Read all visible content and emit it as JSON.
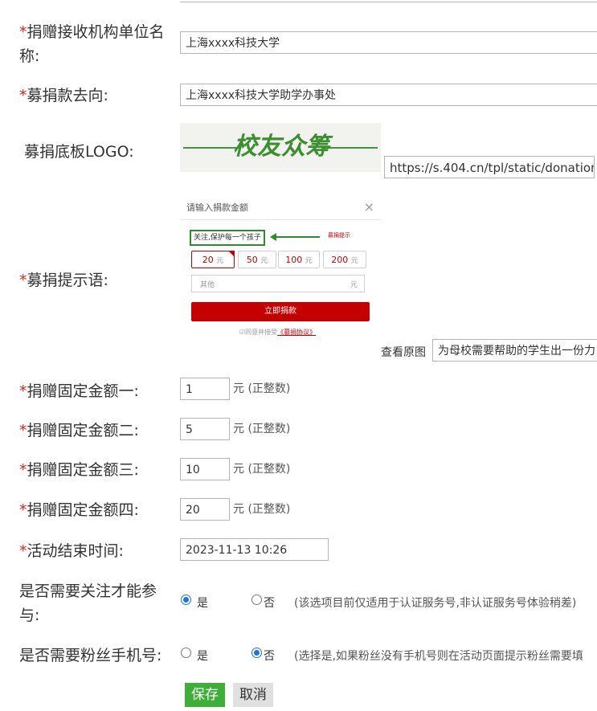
{
  "fields": {
    "org_name": {
      "req": "*",
      "label_line1": "捐赠接收机构单位名",
      "label_line2": "称:",
      "value": "上海xxxx科技大学"
    },
    "destination": {
      "req": "*",
      "label": "募捐款去向:",
      "value": "上海xxxx科技大学助学办事处"
    },
    "logo": {
      "label": "募捐底板LOGO:",
      "logo_text": "校友众筹",
      "url_value": "https://s.404.cn/tpl/static/donation"
    },
    "hint": {
      "req": "*",
      "label": "募捐提示语:",
      "view_original": "查看原图",
      "value": "为母校需要帮助的学生出一份力"
    },
    "amount1": {
      "req": "*",
      "label": "捐赠固定金额一:",
      "value": "1",
      "unit": "元 (正整数)"
    },
    "amount2": {
      "req": "*",
      "label": "捐赠固定金额二:",
      "value": "5",
      "unit": "元 (正整数)"
    },
    "amount3": {
      "req": "*",
      "label": "捐赠固定金额三:",
      "value": "10",
      "unit": "元 (正整数)"
    },
    "amount4": {
      "req": "*",
      "label": "捐赠固定金额四:",
      "value": "20",
      "unit": "元 (正整数)"
    },
    "end_time": {
      "req": "*",
      "label": "活动结束时间:",
      "value": "2023-11-13 10:26"
    },
    "follow": {
      "label_line1": "是否需要关注才能参",
      "label_line2": "与:",
      "yes": "是",
      "no": "否",
      "note": "(该选项目前仅适用于认证服务号,非认证服务号体验稍差)"
    },
    "phone": {
      "label": "是否需要粉丝手机号:",
      "yes": "是",
      "no": "否",
      "note": "(选择是,如果粉丝没有手机号则在活动页面提示粉丝需要填"
    }
  },
  "preview": {
    "header": "请输入捐款金额",
    "close": "×",
    "hint_text": "关注,保护每一个孩子",
    "hint_marker": "募捐提示",
    "amounts": [
      "20",
      "50",
      "100",
      "200"
    ],
    "yuan": "元",
    "other_placeholder": "其他",
    "other_unit": "元",
    "donate_button": "立即捐款",
    "agree_prefix": "同意并接受",
    "agree_link": "《募捐协议》"
  },
  "buttons": {
    "save": "保存",
    "cancel": "取消"
  }
}
